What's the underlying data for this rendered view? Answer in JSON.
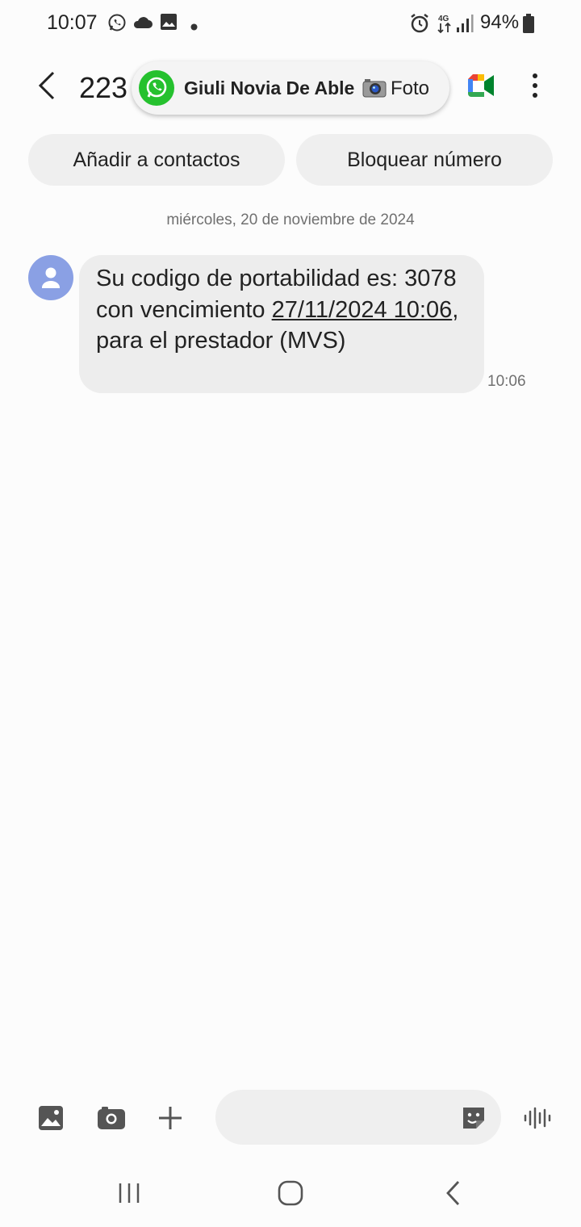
{
  "status_bar": {
    "time": "10:07",
    "battery": "94%",
    "network": "4G",
    "icons": [
      "whatsapp-icon",
      "cloud-icon",
      "gallery-icon",
      "dot-icon",
      "alarm-icon",
      "signal-icon",
      "battery-icon"
    ]
  },
  "header": {
    "title": "223",
    "icons": [
      "back-icon",
      "google-meet-icon",
      "more-options-icon"
    ]
  },
  "notification": {
    "app_icon": "whatsapp-icon",
    "sender": "Giuli Novia De Able",
    "message_icon": "camera-icon",
    "message": "Foto"
  },
  "actions": {
    "add_contact": "Añadir a contactos",
    "block_number": "Bloquear número"
  },
  "conversation": {
    "date": "miércoles, 20 de noviembre de 2024",
    "messages": [
      {
        "sender": "incoming",
        "text_before": "Su codigo de portabilidad es: 3078 con vencimiento ",
        "link": "27/11/2024 10:06",
        "text_after": ", para el prestador (MVS)",
        "time": "10:06"
      }
    ]
  },
  "composer": {
    "placeholder": "",
    "value": "",
    "icons": [
      "gallery-icon",
      "camera-icon",
      "plus-icon",
      "sticker-icon",
      "voice-icon"
    ]
  },
  "nav_bar": {
    "icons": [
      "recent-apps-icon",
      "home-icon",
      "back-icon"
    ]
  },
  "colors": {
    "background": "#fcfcfc",
    "bubble": "#ededed",
    "avatar": "#8aa0e4",
    "whatsapp_green": "#25c12e"
  }
}
